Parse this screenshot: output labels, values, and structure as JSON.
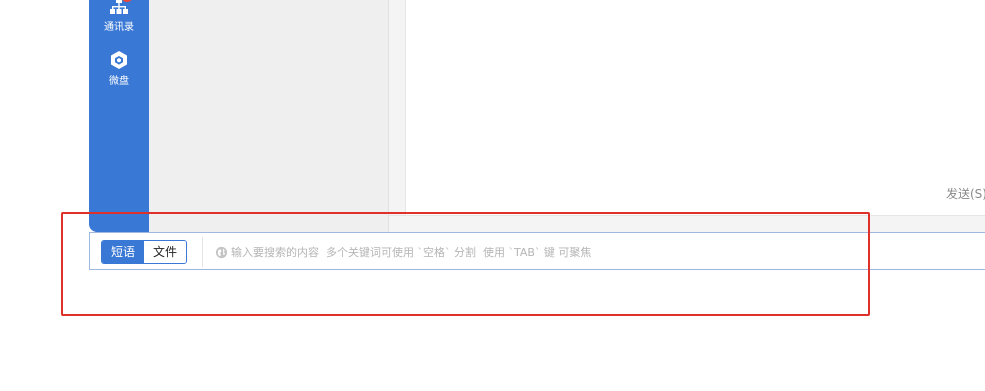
{
  "nav": {
    "items": [
      {
        "label": "通讯录",
        "icon": "org-chart-icon",
        "has_badge": true
      },
      {
        "label": "微盘",
        "icon": "cloud-drive-icon"
      }
    ]
  },
  "chat": {
    "send_label": "发送(S)"
  },
  "quick_bar": {
    "tabs": [
      {
        "label": "短语",
        "active": true
      },
      {
        "label": "文件",
        "active": false
      }
    ],
    "search": {
      "placeholder": "输入要搜索的内容  多个关键词可使用 `空格` 分割  使用 `TAB` 键 可聚焦",
      "value": ""
    }
  },
  "colors": {
    "nav_blue": "#3a78d6",
    "annotation_red": "#e0302a",
    "badge_red": "#e64b3c"
  }
}
